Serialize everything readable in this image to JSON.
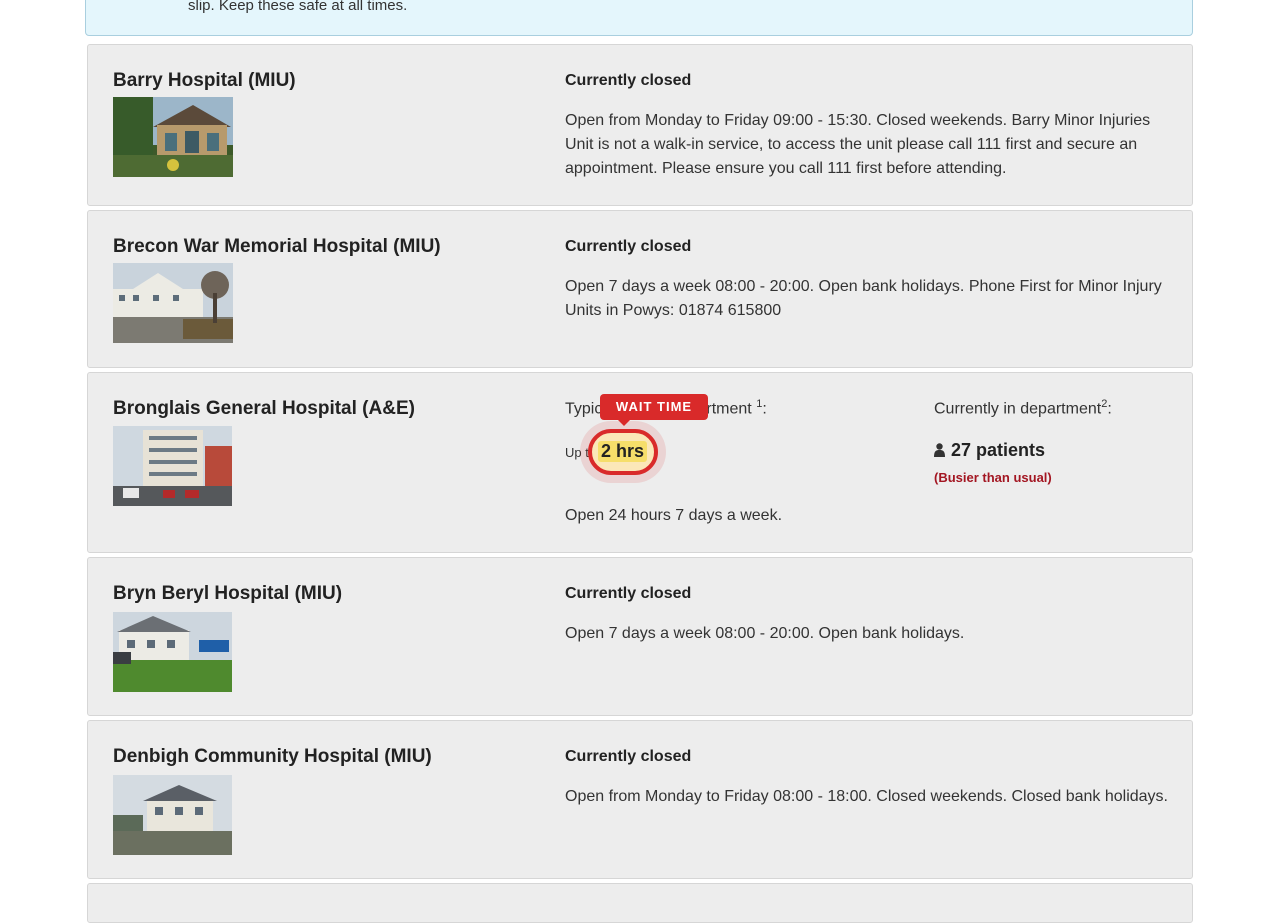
{
  "notice": {
    "text": "slip. Keep these safe at all times."
  },
  "hospitals": [
    {
      "name": "Barry Hospital (MIU)",
      "status": "Currently closed",
      "description": "Open from Monday to Friday 09:00 - 15:30. Closed weekends. Barry Minor Injuries Unit is not a walk-in service, to access the unit please call 111 first and secure an appointment. Please ensure you call 111 first before attending."
    },
    {
      "name": "Brecon War Memorial Hospital (MIU)",
      "status": "Currently closed",
      "description": "Open 7 days a week 08:00 - 20:00. Open bank holidays. Phone First for Minor Injury Units in Powys: 01874 615800"
    },
    {
      "name": "Bronglais General Hospital (A&E)",
      "typical_label": "Typical time in department",
      "typical_sup": "1",
      "typical_suffix": ":",
      "wait_prefix": "Up to",
      "wait_value": "2 hrs",
      "wait_tag": "WAIT TIME",
      "current_label": "Currently in department",
      "current_sup": "2",
      "current_suffix": ":",
      "patients": "27 patients",
      "busier": "(Busier than usual)",
      "description": "Open 24 hours 7 days a week."
    },
    {
      "name": "Bryn Beryl Hospital (MIU)",
      "status": "Currently closed",
      "description": "Open 7 days a week 08:00 - 20:00. Open bank holidays."
    },
    {
      "name": "Denbigh Community Hospital (MIU)",
      "status": "Currently closed",
      "description": "Open from Monday to Friday 08:00 - 18:00. Closed weekends. Closed bank holidays."
    }
  ],
  "colors": {
    "alert_red": "#d92a2a",
    "busier_text": "#a31622",
    "card_bg": "#ededed"
  }
}
